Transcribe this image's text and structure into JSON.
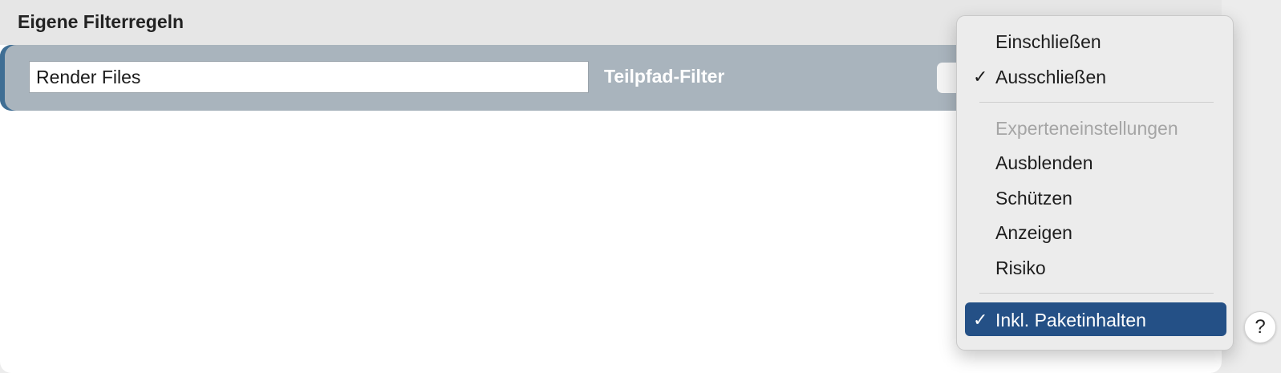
{
  "panel": {
    "title": "Eigene Filterregeln",
    "rule": {
      "name_value": "Render Files",
      "filter_type_label": "Teilpfad-Filter"
    }
  },
  "menu": {
    "items": [
      {
        "label": "Einschließen",
        "checked": false,
        "enabled": true
      },
      {
        "label": "Ausschließen",
        "checked": true,
        "check_mark": "✓",
        "enabled": true
      },
      {
        "label": "Experteneinstellungen",
        "checked": false,
        "enabled": false
      },
      {
        "label": "Ausblenden",
        "checked": false,
        "enabled": true
      },
      {
        "label": "Schützen",
        "checked": false,
        "enabled": true
      },
      {
        "label": "Anzeigen",
        "checked": false,
        "enabled": true
      },
      {
        "label": "Risiko",
        "checked": false,
        "enabled": true
      },
      {
        "label": "Inkl. Paketinhalten",
        "checked": true,
        "check_mark": "✓",
        "enabled": true,
        "highlighted": true
      }
    ]
  },
  "help_button": {
    "label": "?"
  },
  "colors": {
    "rule_row_bg": "#a9b4bd",
    "rule_row_accent": "#3f6e94",
    "menu_highlight": "#245086"
  }
}
